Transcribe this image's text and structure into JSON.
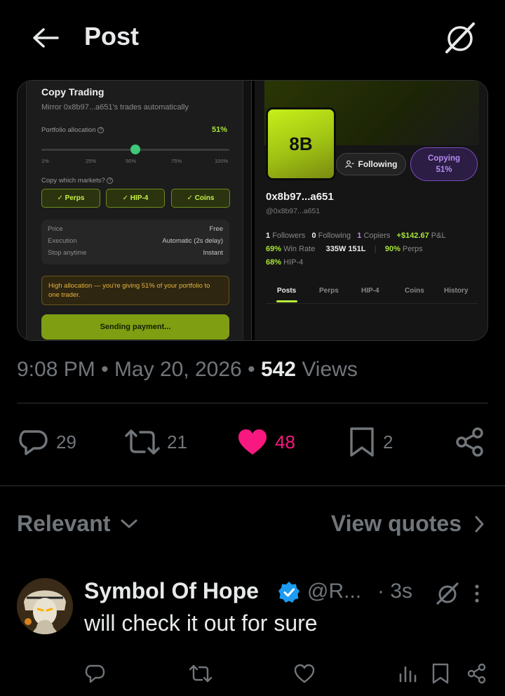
{
  "header": {
    "title": "Post"
  },
  "media": {
    "copy_trading": {
      "title": "Copy Trading",
      "subtitle": "Mirror 0x8b97...a651's trades automatically",
      "allocation_label": "Portfolio allocation",
      "allocation_value": "51%",
      "allocation_level": 0.5,
      "ticks": [
        "1%",
        "25%",
        "50%",
        "75%",
        "100%"
      ],
      "markets_label": "Copy which markets?",
      "markets": [
        "✓ Perps",
        "✓ HIP-4",
        "✓ Coins"
      ],
      "info": [
        {
          "label": "Price",
          "value": "Free"
        },
        {
          "label": "Execution",
          "value": "Automatic (2s delay)"
        },
        {
          "label": "Stop anytime",
          "value": "Instant"
        }
      ],
      "warning": "High allocation — you're giving 51% of your portfolio to one trader.",
      "pay_button": "Sending payment..."
    },
    "profile": {
      "avatar_text": "8B",
      "following_label": "Following",
      "copying_label": "Copying",
      "copying_pct": "51%",
      "name": "0x8b97...a651",
      "handle": "@0x8b97...a651",
      "followers_count": "1",
      "followers_label": "Followers",
      "following_count": "0",
      "following_text": "Following",
      "copiers_count": "1",
      "copiers_label": "Copiers",
      "pnl_value": "+$142.67",
      "pnl_label": "P&L",
      "win_rate_value": "69%",
      "win_rate_label": "Win Rate",
      "record": "335W 151L",
      "perps_value": "90%",
      "perps_label": "Perps",
      "hip4_value": "68%",
      "hip4_label": "HIP-4",
      "tabs": [
        "Posts",
        "Perps",
        "HIP-4",
        "Coins",
        "History"
      ]
    }
  },
  "post_meta": {
    "time": "9:08 PM",
    "sep1": "•",
    "date": "May 20, 2026",
    "sep2": "•",
    "views_count": "542",
    "views_label": "Views"
  },
  "actions": {
    "replies": "29",
    "reposts": "21",
    "likes": "48",
    "bookmarks": "2"
  },
  "replies_section": {
    "sort_label": "Relevant",
    "quotes_label": "View quotes"
  },
  "reply": {
    "name": "Symbol Of Hope",
    "handle": "@R...",
    "time": "· 3s",
    "text": "will check it out for sure"
  },
  "colors": {
    "background": "#000000",
    "text_primary": "#e7e9ea",
    "text_secondary": "#71767b",
    "like": "#f91880",
    "verified": "#1d9bf0",
    "accent_green": "#a8e63a",
    "accent_purple": "#b58cf0"
  },
  "icons": [
    "back-arrow-icon",
    "grok-icon",
    "reply-icon",
    "repost-icon",
    "heart-icon",
    "bookmark-icon",
    "share-icon",
    "chevron-down-icon",
    "chevron-right-icon",
    "verified-badge-icon",
    "more-icon",
    "analytics-icon"
  ]
}
